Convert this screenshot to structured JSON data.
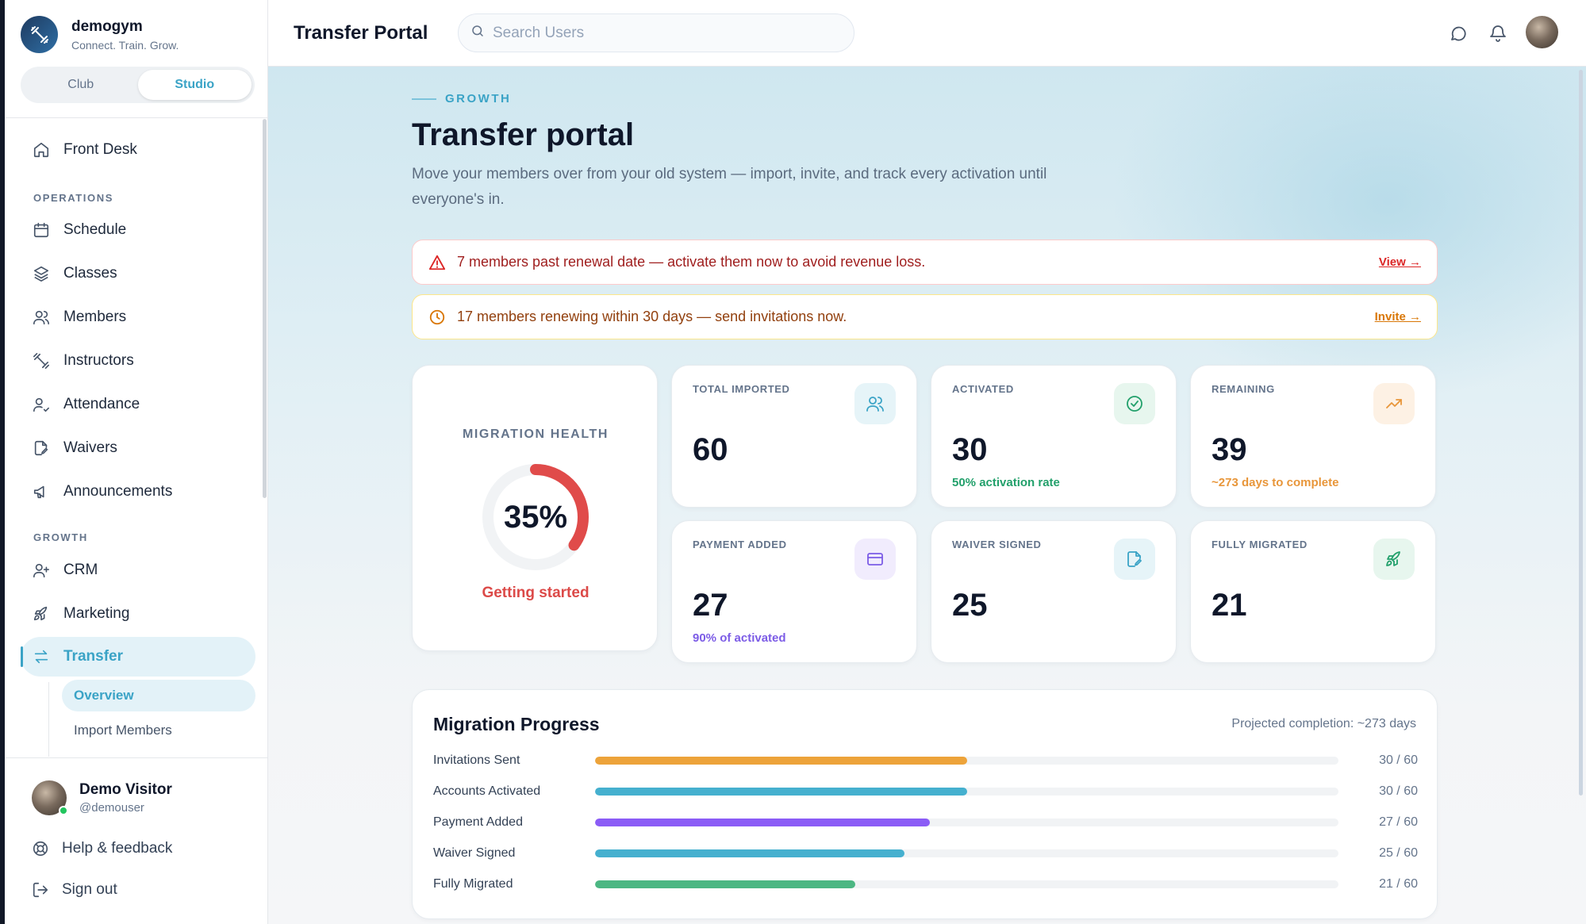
{
  "brand": {
    "name": "demogym",
    "tagline": "Connect. Train. Grow."
  },
  "mode_toggle": {
    "options": [
      "Club",
      "Studio"
    ],
    "selected": "Studio"
  },
  "sidebar": {
    "front_desk": "Front Desk",
    "section_operations": "OPERATIONS",
    "operations": [
      "Schedule",
      "Classes",
      "Members",
      "Instructors",
      "Attendance",
      "Waivers",
      "Announcements"
    ],
    "section_growth": "GROWTH",
    "growth": [
      "CRM",
      "Marketing",
      "Transfer"
    ],
    "transfer_sub": [
      "Overview",
      "Import Members"
    ],
    "active_item": "Transfer",
    "active_sub": "Overview"
  },
  "user": {
    "name": "Demo Visitor",
    "handle": "@demouser"
  },
  "footer": {
    "help": "Help & feedback",
    "signout": "Sign out"
  },
  "header": {
    "title": "Transfer Portal",
    "search_placeholder": "Search Users"
  },
  "page": {
    "eyebrow": "GROWTH",
    "title": "Transfer portal",
    "description": "Move your members over from your old system — import, invite, and track every activation until everyone's in."
  },
  "alerts": {
    "danger": {
      "text": "7 members past renewal date — activate them now to avoid revenue loss.",
      "link": "View →"
    },
    "warning": {
      "text": "17 members renewing within 30 days — send invitations now.",
      "link": "Invite →"
    }
  },
  "health": {
    "label": "MIGRATION HEALTH",
    "percent": 35,
    "percent_text": "35%",
    "status": "Getting started",
    "color": "#e04b4a"
  },
  "stats": [
    {
      "label": "TOTAL IMPORTED",
      "value": "60",
      "sub": "",
      "icon": "users-icon",
      "icon_bg": "#e6f4f8",
      "icon_color": "#3aa3c6",
      "sub_color": "#64748b"
    },
    {
      "label": "ACTIVATED",
      "value": "30",
      "sub": "50% activation rate",
      "icon": "check-circle-icon",
      "icon_bg": "#e7f6ee",
      "icon_color": "#22a06b",
      "sub_color": "#22a06b"
    },
    {
      "label": "REMAINING",
      "value": "39",
      "sub": "~273 days to complete",
      "icon": "trending-up-icon",
      "icon_bg": "#fdf1e4",
      "icon_color": "#e8963a",
      "sub_color": "#e8963a"
    },
    {
      "label": "PAYMENT ADDED",
      "value": "27",
      "sub": "90% of activated",
      "icon": "credit-card-icon",
      "icon_bg": "#f1ecfd",
      "icon_color": "#7c5ce6",
      "sub_color": "#7c5ce6"
    },
    {
      "label": "WAIVER SIGNED",
      "value": "25",
      "sub": "",
      "icon": "file-signature-icon",
      "icon_bg": "#e6f4f8",
      "icon_color": "#3aa3c6",
      "sub_color": "#64748b"
    },
    {
      "label": "FULLY MIGRATED",
      "value": "21",
      "sub": "",
      "icon": "rocket-icon",
      "icon_bg": "#e7f6ee",
      "icon_color": "#22a06b",
      "sub_color": "#64748b"
    }
  ],
  "progress": {
    "title": "Migration Progress",
    "projection": "Projected completion: ~273 days",
    "rows": [
      {
        "label": "Invitations Sent",
        "value": 30,
        "total": 60,
        "count": "30 / 60",
        "color": "#eda33a"
      },
      {
        "label": "Accounts Activated",
        "value": 30,
        "total": 60,
        "count": "30 / 60",
        "color": "#45b0cf"
      },
      {
        "label": "Payment Added",
        "value": 27,
        "total": 60,
        "count": "27 / 60",
        "color": "#8b5cf6"
      },
      {
        "label": "Waiver Signed",
        "value": 25,
        "total": 60,
        "count": "25 / 60",
        "color": "#45b0cf"
      },
      {
        "label": "Fully Migrated",
        "value": 21,
        "total": 60,
        "count": "21 / 60",
        "color": "#4cb783"
      }
    ]
  }
}
